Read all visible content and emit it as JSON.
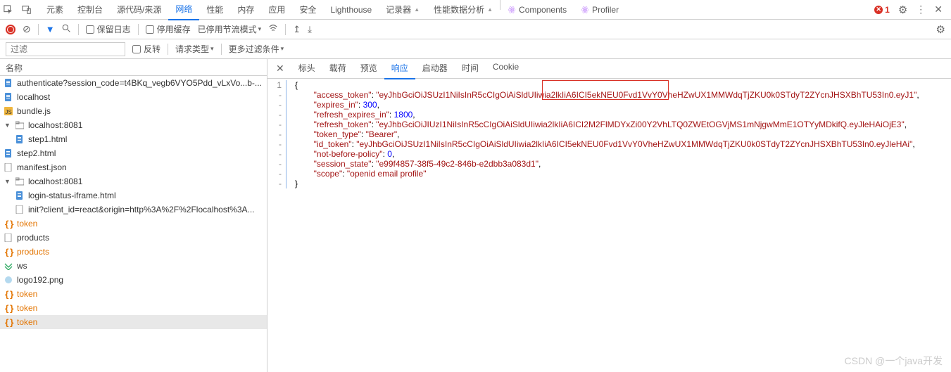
{
  "top_tabs": {
    "items": [
      "元素",
      "控制台",
      "源代码/来源",
      "网络",
      "性能",
      "内存",
      "应用",
      "安全",
      "Lighthouse",
      "记录器",
      "性能数据分析"
    ],
    "active": 3,
    "ext": [
      "Components",
      "Profiler"
    ],
    "error_count": "1"
  },
  "toolbar": {
    "preserve_log": "保留日志",
    "disable_cache": "停用缓存",
    "throttle": "已停用节流模式"
  },
  "filter_bar": {
    "placeholder": "过滤",
    "invert": "反转",
    "request_type": "请求类型",
    "more": "更多过滤条件"
  },
  "name_header": "名称",
  "requests": [
    {
      "name": "authenticate?session_code=t4BKq_vegb6VYO5Pdd_vLxVo...b-...",
      "icon": "doc-blue",
      "indent": 0
    },
    {
      "name": "localhost",
      "icon": "doc-blue",
      "indent": 0
    },
    {
      "name": "bundle.js",
      "icon": "js",
      "indent": 0
    },
    {
      "name": "localhost:8081",
      "icon": "folder",
      "indent": 0,
      "caret": "▼"
    },
    {
      "name": "step1.html",
      "icon": "doc-blue",
      "indent": 1
    },
    {
      "name": "step2.html",
      "icon": "doc-blue",
      "indent": 0
    },
    {
      "name": "manifest.json",
      "icon": "doc",
      "indent": 0
    },
    {
      "name": "localhost:8081",
      "icon": "folder",
      "indent": 0,
      "caret": "▼"
    },
    {
      "name": "login-status-iframe.html",
      "icon": "doc-blue",
      "indent": 1
    },
    {
      "name": "init?client_id=react&origin=http%3A%2F%2Flocalhost%3A...",
      "icon": "doc",
      "indent": 1
    },
    {
      "name": "token",
      "icon": "braces",
      "indent": 0,
      "orange": true
    },
    {
      "name": "products",
      "icon": "doc",
      "indent": 0
    },
    {
      "name": "products",
      "icon": "braces",
      "indent": 0,
      "orange": true
    },
    {
      "name": "ws",
      "icon": "ws",
      "indent": 0
    },
    {
      "name": "logo192.png",
      "icon": "img",
      "indent": 0
    },
    {
      "name": "token",
      "icon": "braces",
      "indent": 0,
      "orange": true
    },
    {
      "name": "token",
      "icon": "braces",
      "indent": 0,
      "orange": true
    },
    {
      "name": "token",
      "icon": "braces",
      "indent": 0,
      "orange": true,
      "selected": true
    }
  ],
  "resp_tabs": {
    "items": [
      "标头",
      "载荷",
      "预览",
      "响应",
      "启动器",
      "时间",
      "Cookie"
    ],
    "active": 3
  },
  "response_json": [
    {
      "g": "1",
      "t": "{"
    },
    {
      "g": "-",
      "i": 2,
      "k": "access_token",
      "v": "eyJhbGciOiJSUzI1NiIsInR5cCIgOiAiSldUIiwia2lkIiA6ICI5ekNEU0Fvd1VvY0VheHZwUX1MMWdqTjZKU0k0STdyT2ZYcnJHSXBhTU53In0.eyJ1",
      "str": true
    },
    {
      "g": "-",
      "i": 2,
      "k": "expires_in",
      "v": "300",
      "num": true
    },
    {
      "g": "-",
      "i": 2,
      "k": "refresh_expires_in",
      "v": "1800",
      "num": true
    },
    {
      "g": "-",
      "i": 2,
      "k": "refresh_token",
      "v": "eyJhbGciOiJIUzI1NiIsInR5cCIgOiAiSldUIiwia2lkIiA6ICI2M2FlMDYxZi00Y2VhLTQ0ZWEtOGVjMS1mNjgwMmE1OTYyMDkifQ.eyJleHAiOjE3",
      "str": true
    },
    {
      "g": "-",
      "i": 2,
      "k": "token_type",
      "v": "Bearer",
      "str": true
    },
    {
      "g": "-",
      "i": 2,
      "k": "id_token",
      "v": "eyJhbGciOiJSUzI1NiIsInR5cCIgOiAiSldUIiwia2lkIiA6ICI5ekNEU0Fvd1VvY0VheHZwUX1MMWdqTjZKU0k0STdyT2ZYcnJHSXBhTU53In0.eyJleHAi",
      "str": true
    },
    {
      "g": "-",
      "i": 2,
      "k": "not-before-policy",
      "v": "0",
      "num": true
    },
    {
      "g": "-",
      "i": 2,
      "k": "session_state",
      "v": "e99f4857-38f5-49c2-846b-e2dbb3a083d1",
      "str": true
    },
    {
      "g": "-",
      "i": 2,
      "k": "scope",
      "v": "openid email profile",
      "str": true,
      "last": true
    },
    {
      "g": "-",
      "t": "}"
    }
  ],
  "watermark": "CSDN @一个java开发"
}
